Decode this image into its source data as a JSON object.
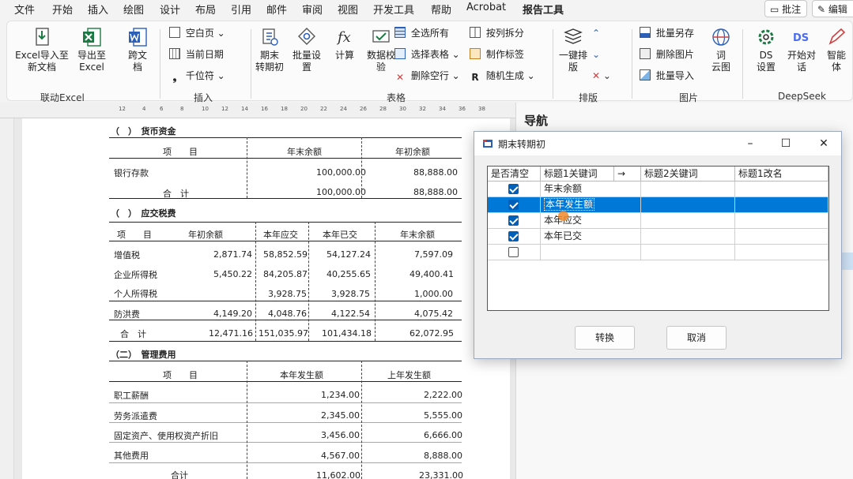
{
  "menu": {
    "items": [
      "文件",
      "开始",
      "插入",
      "绘图",
      "设计",
      "布局",
      "引用",
      "邮件",
      "审阅",
      "视图",
      "开发工具",
      "帮助",
      "Acrobat",
      "报告工具"
    ],
    "comment_button": "批注",
    "edit_button": "编辑"
  },
  "ribbon": {
    "excel_import": "Excel导入至\n新文档",
    "export_excel": "导出至\nExcel",
    "cross_doc": "跨文\n档",
    "blank_page": "空白页",
    "current_date": "当前日期",
    "thousand_sep": "千位符",
    "period_convert": "期末\n转期初",
    "batch_set": "批量设\n置",
    "calc": "计算",
    "data_check": "数据校\n验",
    "select_all": "全选所有",
    "select_table": "选择表格",
    "delete_empty_rows": "删除空行",
    "split_by_column": "按列拆分",
    "make_label": "制作标签",
    "random_gen": "随机生成",
    "one_key_layout": "一键排\n版",
    "batch_save_as": "批量另存",
    "delete_images": "删除图片",
    "batch_import": "批量导入",
    "wordcloud": "词\n云图",
    "ds_settings": "DS\n设置",
    "start_chat": "开始对\n话",
    "agent": "智能\n体",
    "groups": {
      "link_excel": "联动Excel",
      "insert": "插入",
      "table": "表格",
      "layout": "排版",
      "image": "图片",
      "deepseek": "DeepSeek"
    }
  },
  "nav": {
    "title": "导航"
  },
  "document": {
    "sec1_title": "（　）　货币资金",
    "sec1_headers": [
      "项　　目",
      "年末余额",
      "年初余额"
    ],
    "sec1_rows": [
      [
        "银行存款",
        "",
        "100,000.00",
        "88,888.00"
      ],
      [
        "",
        "合　计",
        "100,000.00",
        "88,888.00"
      ]
    ],
    "sec2_title": "（　）　应交税费",
    "sec2_headers": [
      "项　　目",
      "年初余额",
      "本年应交",
      "本年已交",
      "年末余额"
    ],
    "sec2_rows": [
      [
        "增值税",
        "2,871.74",
        "58,852.59",
        "54,127.24",
        "7,597.09"
      ],
      [
        "企业所得税",
        "5,450.22",
        "84,205.87",
        "40,255.65",
        "49,400.41"
      ],
      [
        "个人所得税",
        "",
        "3,928.75",
        "3,928.75",
        "1,000.00"
      ],
      [
        "防洪费",
        "4,149.20",
        "4,048.76",
        "4,122.54",
        "4,075.42"
      ],
      [
        "合　计",
        "12,471.16",
        "151,035.97",
        "101,434.18",
        "62,072.95"
      ]
    ],
    "sec3_title": "（二）　管理费用",
    "sec3_headers": [
      "项　　目",
      "本年发生额",
      "上年发生额"
    ],
    "sec3_rows": [
      [
        "职工薪酬",
        "1,234.00",
        "2,222.00"
      ],
      [
        "劳务派遣费",
        "2,345.00",
        "5,555.00"
      ],
      [
        "固定资产、使用权资产折旧",
        "3,456.00",
        "6,666.00"
      ],
      [
        "其他费用",
        "4,567.00",
        "8,888.00"
      ],
      [
        "合计",
        "11,602.00",
        "23,331.00"
      ]
    ],
    "ruler_ticks": [
      "12",
      "4",
      "6",
      "8",
      "10",
      "12",
      "14",
      "16",
      "18",
      "20",
      "22",
      "24",
      "26",
      "28",
      "30",
      "32",
      "34",
      "36",
      "38"
    ]
  },
  "dialog": {
    "title": "期末转期初",
    "columns": [
      "是否清空",
      "标题1关键词",
      "→",
      "标题2关键词",
      "标题1改名"
    ],
    "rows": [
      {
        "checked": true,
        "keyword1": "年末余额",
        "keyword2": "",
        "rename": "",
        "selected": false
      },
      {
        "checked": true,
        "keyword1": "本年发生额",
        "keyword2": "",
        "rename": "",
        "selected": true
      },
      {
        "checked": true,
        "keyword1": "本年应交",
        "keyword2": "",
        "rename": "",
        "selected": false
      },
      {
        "checked": true,
        "keyword1": "本年已交",
        "keyword2": "",
        "rename": "",
        "selected": false
      },
      {
        "checked": false,
        "keyword1": "",
        "keyword2": "",
        "rename": "",
        "selected": false
      }
    ],
    "convert_button": "转换",
    "cancel_button": "取消"
  },
  "colors": {
    "selection": "#0078d7",
    "checkbox": "#005fb8",
    "excel_green": "#1d7a45",
    "word_blue": "#2b5fb8",
    "deepseek_blue": "#4b6cf0"
  }
}
